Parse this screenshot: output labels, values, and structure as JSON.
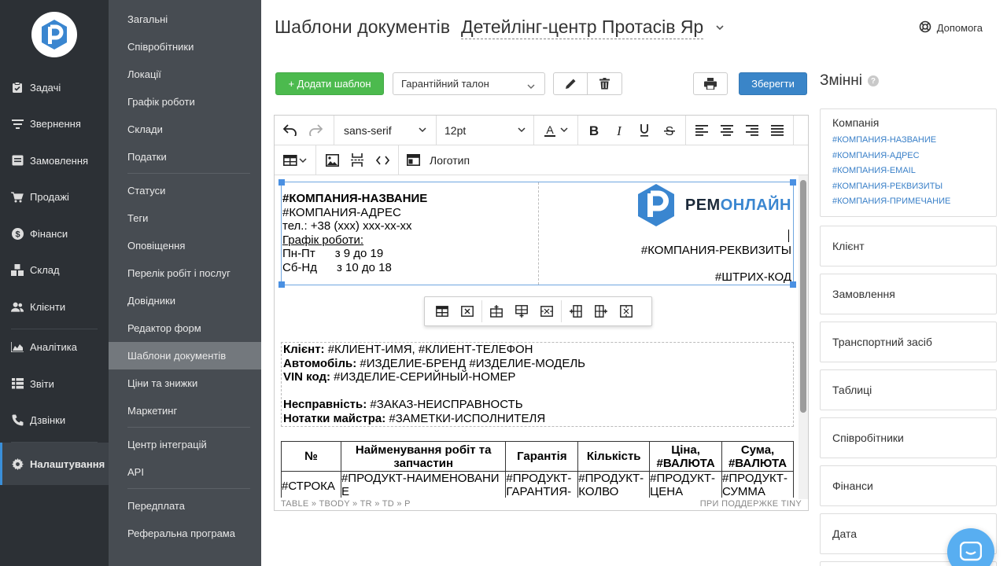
{
  "nav": {
    "items": [
      {
        "label": "Задачі",
        "icon": "clipboard-check-icon"
      },
      {
        "label": "Звернення",
        "icon": "filter-lines-icon"
      },
      {
        "label": "Замовлення",
        "icon": "order-box-icon"
      },
      {
        "label": "Продажі",
        "icon": "cart-icon"
      },
      {
        "label": "Фінанси",
        "icon": "dollar-circle-icon"
      },
      {
        "label": "Склад",
        "icon": "boxes-icon"
      },
      {
        "label": "Клієнти",
        "icon": "users-icon"
      },
      {
        "label": "Аналітика",
        "icon": "area-chart-icon"
      },
      {
        "label": "Звіти",
        "icon": "report-list-icon"
      },
      {
        "label": "Дзвінки",
        "icon": "phone-icon"
      },
      {
        "label": "Налаштування",
        "icon": "gear-icon"
      }
    ]
  },
  "subnav": {
    "group1": [
      "Загальні",
      "Співробітники",
      "Локації",
      "Графік роботи",
      "Склади",
      "Податки"
    ],
    "group2": [
      "Статуси",
      "Теги",
      "Оповіщення",
      "Перелік робіт і послуг",
      "Довідники",
      "Редактор форм",
      "Шаблони документів",
      "Ціни та знижки",
      "Маркетинг"
    ],
    "group3": [
      "Центр інтеграцій",
      "API"
    ],
    "group4": [
      "Передплата",
      "Реферальна програма"
    ]
  },
  "header": {
    "title": "Шаблони документів",
    "company": "Детейлінг-центр Протасів Яр",
    "help": "Допомога"
  },
  "toolbar": {
    "add_label": "+ Додати шаблон",
    "template_selected": "Гарантійний талон",
    "save_label": "Зберегти"
  },
  "editor": {
    "font_family": "sans-serif",
    "font_size": "12pt",
    "logo_label": "Логотип",
    "status_path": "TABLE » TBODY » TR » TD » P",
    "status_brand": "ПРИ ПОДДЕРЖКЕ TINY",
    "header_left": [
      {
        "text": "#КОМПАНИЯ-НАЗВАНИЕ",
        "bold": true
      },
      {
        "text": "#КОМПАНИЯ-АДРЕС"
      },
      {
        "text": "тел.: +38 (xxx) xxx-xx-xx"
      },
      {
        "text": "Графік роботи:",
        "underline": true
      },
      {
        "text": "Пн-Пт      з 9 до 19"
      },
      {
        "text": "Сб-Нд      з 10 до 18"
      }
    ],
    "logo_text_dark": "РЕМ",
    "logo_text_blue": "ОНЛАЙН",
    "requisites": "#КОМПАНИЯ-РЕКВИЗИТЫ",
    "barcode": "#ШТРИХ-КОД",
    "client_lines": [
      {
        "label": "Клієнт:",
        "value": " #КЛИЕНТ-ИМЯ, #КЛИЕНТ-ТЕЛЕФОН"
      },
      {
        "label": "Автомобіль:",
        "value": " #ИЗДЕЛИЕ-БРЕНД #ИЗДЕЛИЕ-МОДЕЛЬ"
      },
      {
        "label": "VIN код:",
        "value": " #ИЗДЕЛИЕ-СЕРИЙНЫЙ-НОМЕР"
      },
      {
        "label": "",
        "value": ""
      },
      {
        "label": "Несправність:",
        "value": " #ЗАКАЗ-НЕИСПРАВНОСТЬ"
      },
      {
        "label": "Нотатки майстра:",
        "value": " #ЗАМЕТКИ-ИСПОЛНИТЕЛЯ"
      }
    ],
    "table_headers": [
      "№",
      "Найменування робіт та запчастин",
      "Гарантія",
      "Кількість",
      "Ціна, #ВАЛЮТА",
      "Сума, #ВАЛЮТА"
    ],
    "table_row": [
      "#СТРОКА",
      "#ПРОДУКТ-НАИМЕНОВАНИЕ",
      "#ПРОДУКТ-ГАРАНТИЯ-",
      "#ПРОДУКТ-КОЛВО",
      "#ПРОДУКТ-ЦЕНА",
      "#ПРОДУКТ-СУММА"
    ]
  },
  "vars": {
    "title": "Змінні",
    "help_mark": "?",
    "company": {
      "title": "Компанія",
      "chips": [
        "#КОМПАНИЯ-НАЗВАНИЕ",
        "#КОМПАНИЯ-АДРЕС",
        "#КОМПАНИЯ-EMAIL",
        "#КОМПАНИЯ-РЕКВИЗИТЫ",
        "#КОМПАНИЯ-ПРИМЕЧАНИЕ"
      ]
    },
    "sections": [
      "Клієнт",
      "Замовлення",
      "Транспортний засіб",
      "Таблиці",
      "Співробітники",
      "Фінанси",
      "Дата"
    ]
  },
  "colors": {
    "nav_bg": "#2c3035",
    "subnav_bg": "#474c52",
    "accent_blue": "#3a85c8",
    "add_green": "#4cba4e",
    "chip_blue": "#3a80c8"
  }
}
